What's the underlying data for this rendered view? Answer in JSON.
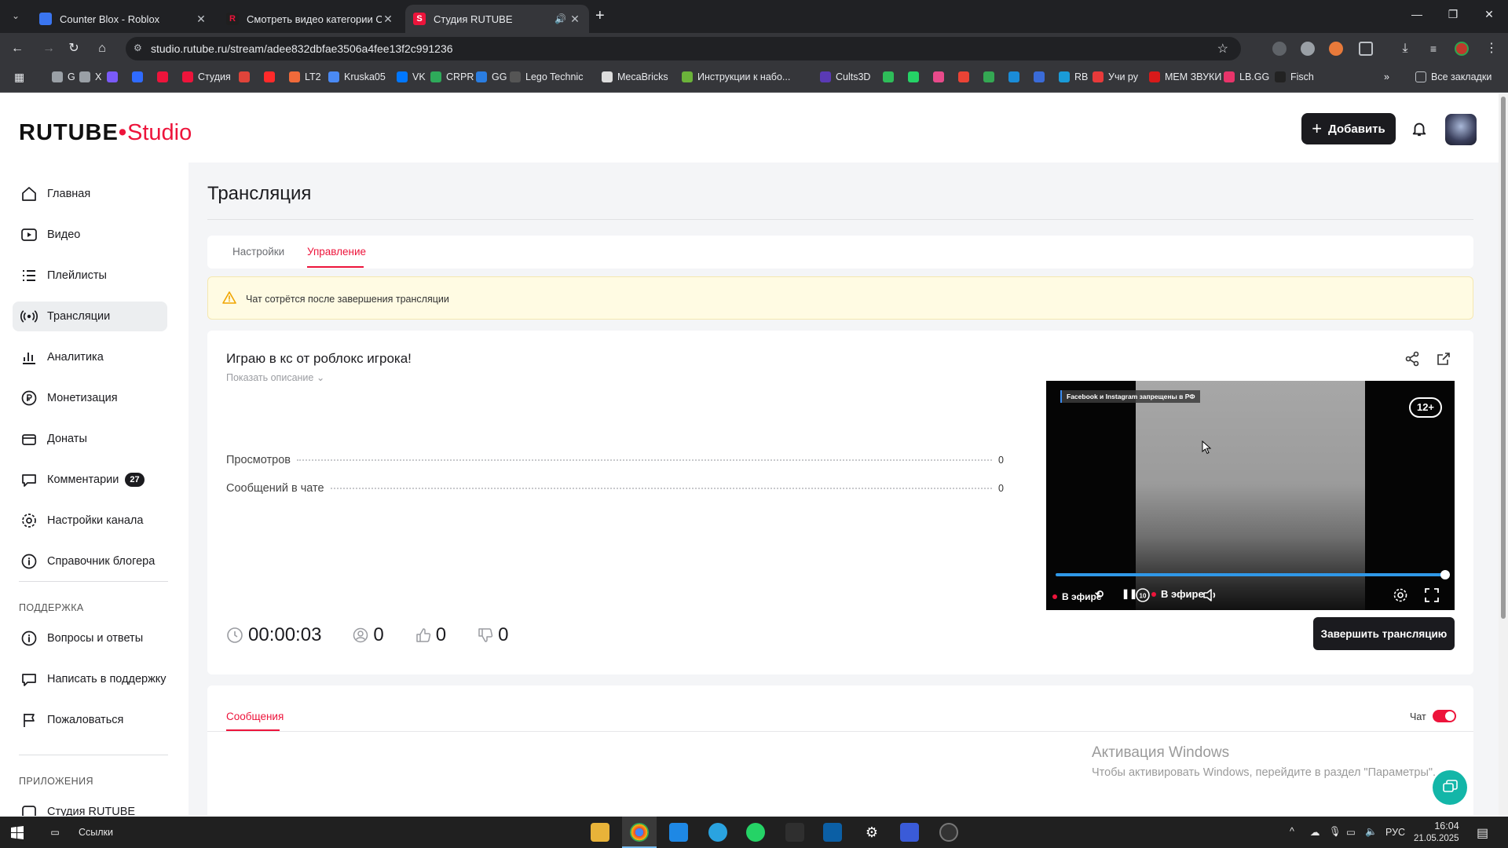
{
  "browser": {
    "tabs": [
      {
        "title": "Counter Blox - Roblox",
        "favicon_color": "#3a75f0"
      },
      {
        "title": "Смотреть видео категории Об",
        "favicon_color": "#1f1f1f"
      },
      {
        "title": "Студия RUTUBE",
        "favicon_color": "#ed143b"
      }
    ],
    "url": "studio.rutube.ru/stream/adee832dbfae3506a4fee13f2c991236",
    "bookmarks": [
      {
        "label": "G",
        "color": "#9aa0a6"
      },
      {
        "label": "X",
        "color": "#9aa0a6"
      },
      {
        "label": "",
        "color": "#7a5af8"
      },
      {
        "label": "",
        "color": "#2f6bff"
      },
      {
        "label": "",
        "color": "#ed143b"
      },
      {
        "label": "Студия",
        "color": "#ed143b"
      },
      {
        "label": "",
        "color": "#e0443a"
      },
      {
        "label": "",
        "color": "#ff2a2a"
      },
      {
        "label": "LT2",
        "color": "#f06a3a"
      },
      {
        "label": "Kruska05",
        "color": "#4a8af4"
      },
      {
        "label": "VK",
        "color": "#0077ff"
      },
      {
        "label": "CRPR",
        "color": "#2eaa5a"
      },
      {
        "label": "GG",
        "color": "#2a7de1"
      },
      {
        "label": "Lego Technic",
        "color": "#555"
      },
      {
        "label": "MecaBricks",
        "color": "#ddd"
      },
      {
        "label": "Инструкции к набо...",
        "color": "#6bb33a"
      },
      {
        "label": "Cults3D",
        "color": "#5a3ab5"
      },
      {
        "label": "",
        "color": "#2ebd59"
      },
      {
        "label": "",
        "color": "#25d366"
      },
      {
        "label": "",
        "color": "#e84a8a"
      },
      {
        "label": "",
        "color": "#ea4335"
      },
      {
        "label": "",
        "color": "#34a853"
      },
      {
        "label": "",
        "color": "#1a8cd8"
      },
      {
        "label": "",
        "color": "#3a6bd8"
      },
      {
        "label": "RB",
        "color": "#1a9bd8"
      },
      {
        "label": "Учи ру",
        "color": "#e83a3a"
      },
      {
        "label": "МЕМ ЗВУКИ",
        "color": "#d81a1a"
      },
      {
        "label": "LB.GG",
        "color": "#e8346a"
      },
      {
        "label": "Fisch",
        "color": "#222"
      }
    ],
    "all_bookmarks": "Все закладки"
  },
  "header": {
    "logo_main": "RUTUBE",
    "logo_sub": "Studio",
    "add_button": "Добавить"
  },
  "sidebar": {
    "items": [
      {
        "label": "Главная",
        "icon": "home-icon"
      },
      {
        "label": "Видео",
        "icon": "video-icon"
      },
      {
        "label": "Плейлисты",
        "icon": "playlist-icon"
      },
      {
        "label": "Трансляции",
        "icon": "broadcast-icon",
        "active": true
      },
      {
        "label": "Аналитика",
        "icon": "analytics-icon"
      },
      {
        "label": "Монетизация",
        "icon": "monetization-icon"
      },
      {
        "label": "Донаты",
        "icon": "donate-icon"
      },
      {
        "label": "Комментарии",
        "icon": "comments-icon",
        "badge": "27"
      },
      {
        "label": "Настройки канала",
        "icon": "settings-icon"
      },
      {
        "label": "Справочник блогера",
        "icon": "info-icon"
      }
    ],
    "support_heading": "ПОДДЕРЖКА",
    "support_items": [
      {
        "label": "Вопросы и ответы",
        "icon": "faq-icon"
      },
      {
        "label": "Написать в поддержку",
        "icon": "mail-icon"
      },
      {
        "label": "Пожаловаться",
        "icon": "flag-icon"
      }
    ],
    "apps_heading": "ПРИЛОЖЕНИЯ",
    "apps_items": [
      {
        "label": "Студия RUTUBE",
        "icon": "app-icon"
      }
    ]
  },
  "main": {
    "title": "Трансляция",
    "tabs": [
      {
        "label": "Настройки"
      },
      {
        "label": "Управление",
        "active": true
      }
    ],
    "warning": "Чат сотрётся после завершения трансляции",
    "stream": {
      "title": "Играю в кс от роблокс игрока!",
      "show_description": "Показать описание",
      "stats": [
        {
          "label": "Просмотров",
          "value": "0"
        },
        {
          "label": "Сообщений в чате",
          "value": "0"
        }
      ],
      "duration": "00:00:03",
      "viewers": "0",
      "likes": "0",
      "dislikes": "0",
      "end_button": "Завершить трансляцию"
    },
    "player": {
      "notice": "Facebook и Instagram запрещены в РФ",
      "age_rating": "12+",
      "live_label_left": "В эфире",
      "live_label": "В эфире",
      "progress": 1.0
    },
    "chat": {
      "tab_label": "Сообщения",
      "toggle_label": "Чат",
      "toggle_on": true
    }
  },
  "overlay": {
    "watermark_title": "Активация Windows",
    "watermark_text": "Чтобы активировать Windows, перейдите в раздел \"Параметры\"."
  },
  "taskbar": {
    "links_label": "Ссылки",
    "language": "РУС",
    "time": "16:04",
    "date": "21.05.2025"
  },
  "colors": {
    "accent": "#ed143b",
    "dark": "#1b1b1f",
    "warning_bg": "#fffbe3",
    "progress": "#2f98e8"
  }
}
